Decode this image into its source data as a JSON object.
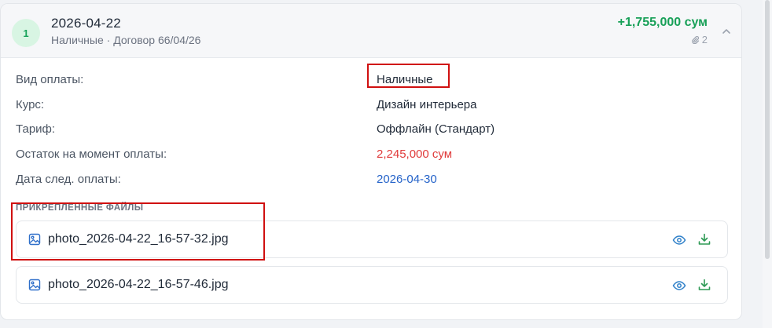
{
  "payment": {
    "index": "1",
    "date": "2026-04-22",
    "subtitle": "Наличные · Договор 66/04/26",
    "amount": "+1,755,000 сум",
    "attachments_count": "2"
  },
  "details": [
    {
      "label": "Вид оплаты:",
      "value": "Наличные",
      "tone": "default"
    },
    {
      "label": "Курс:",
      "value": "Дизайн интерьера",
      "tone": "default"
    },
    {
      "label": "Тариф:",
      "value": "Оффлайн (Стандарт)",
      "tone": "default"
    },
    {
      "label": "Остаток на момент оплаты:",
      "value": "2,245,000 сум",
      "tone": "red"
    },
    {
      "label": "Дата след. оплаты:",
      "value": "2026-04-30",
      "tone": "blue"
    }
  ],
  "files_section": {
    "title": "ПРИКРЕПЛЁННЫЕ ФАЙЛЫ",
    "files": [
      {
        "name": "photo_2026-04-22_16-57-32.jpg"
      },
      {
        "name": "photo_2026-04-22_16-57-46.jpg"
      }
    ]
  },
  "icons": {
    "file": "image-file-icon",
    "view": "eye-icon",
    "download": "download-icon",
    "attachment": "paperclip-icon",
    "collapse": "chevron-up-icon"
  },
  "colors": {
    "accent_green": "#18a058",
    "remaining_red": "#e03b3b",
    "date_blue": "#2563c9",
    "highlight_red": "#d01010",
    "view_icon_blue": "#2f80c9",
    "download_icon_green": "#2e9a55"
  }
}
